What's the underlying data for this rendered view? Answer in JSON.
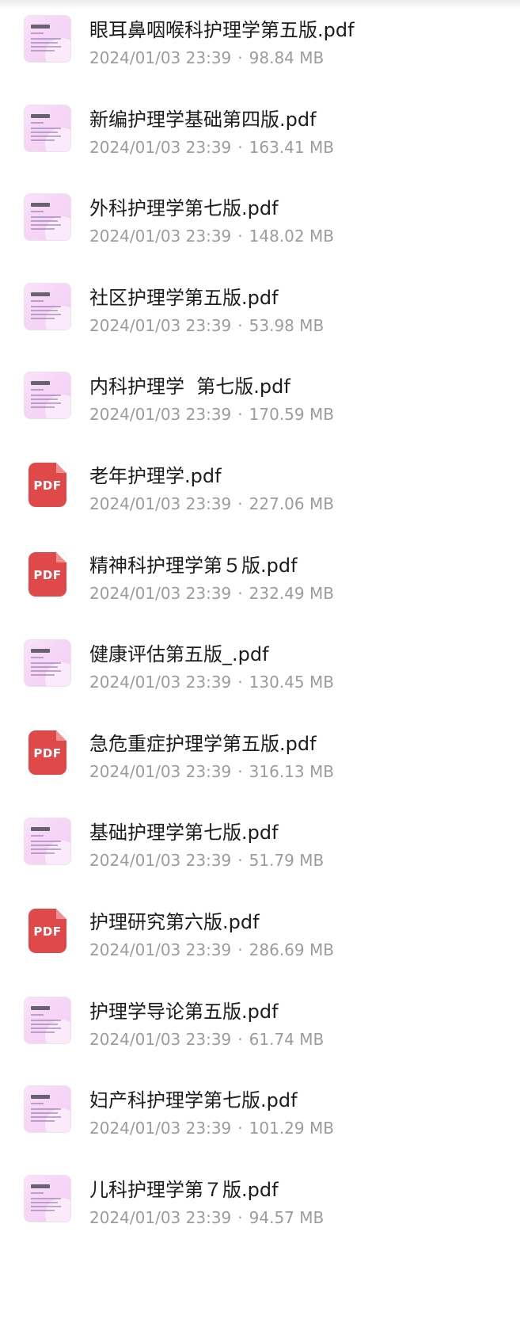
{
  "files": [
    {
      "name": "眼耳鼻咽喉科护理学第五版.pdf",
      "date": "2024/01/03 23:39",
      "size": "98.84 MB",
      "icon": "cover-thumbnail-icon"
    },
    {
      "name": "新编护理学基础第四版.pdf",
      "date": "2024/01/03 23:39",
      "size": "163.41 MB",
      "icon": "cover-thumbnail-icon"
    },
    {
      "name": "外科护理学第七版.pdf",
      "date": "2024/01/03 23:39",
      "size": "148.02 MB",
      "icon": "cover-thumbnail-icon"
    },
    {
      "name": "社区护理学第五版.pdf",
      "date": "2024/01/03 23:39",
      "size": "53.98 MB",
      "icon": "cover-thumbnail-icon"
    },
    {
      "name": "内科护理学  第七版.pdf",
      "date": "2024/01/03 23:39",
      "size": "170.59 MB",
      "icon": "cover-thumbnail-icon"
    },
    {
      "name": "老年护理学.pdf",
      "date": "2024/01/03 23:39",
      "size": "227.06 MB",
      "icon": "pdf-file-icon",
      "badge": "PDF"
    },
    {
      "name": "精神科护理学第５版.pdf",
      "date": "2024/01/03 23:39",
      "size": "232.49 MB",
      "icon": "pdf-file-icon",
      "badge": "PDF"
    },
    {
      "name": "健康评估第五版_.pdf",
      "date": "2024/01/03 23:39",
      "size": "130.45 MB",
      "icon": "cover-thumbnail-icon"
    },
    {
      "name": "急危重症护理学第五版.pdf",
      "date": "2024/01/03 23:39",
      "size": "316.13 MB",
      "icon": "pdf-file-icon",
      "badge": "PDF"
    },
    {
      "name": "基础护理学第七版.pdf",
      "date": "2024/01/03 23:39",
      "size": "51.79 MB",
      "icon": "cover-thumbnail-icon"
    },
    {
      "name": "护理研究第六版.pdf",
      "date": "2024/01/03 23:39",
      "size": "286.69 MB",
      "icon": "pdf-file-icon",
      "badge": "PDF"
    },
    {
      "name": "护理学导论第五版.pdf",
      "date": "2024/01/03 23:39",
      "size": "61.74 MB",
      "icon": "cover-thumbnail-icon"
    },
    {
      "name": "妇产科护理学第七版.pdf",
      "date": "2024/01/03 23:39",
      "size": "101.29 MB",
      "icon": "cover-thumbnail-icon"
    },
    {
      "name": "儿科护理学第７版.pdf",
      "date": "2024/01/03 23:39",
      "size": "94.57 MB",
      "icon": "cover-thumbnail-icon"
    }
  ],
  "meta_separator": "·",
  "colors": {
    "name_text": "#1c1c1c",
    "meta_text": "#9c9c9c",
    "pdf_icon": "#e0494a",
    "cover_pink": "#f6d6f7"
  }
}
